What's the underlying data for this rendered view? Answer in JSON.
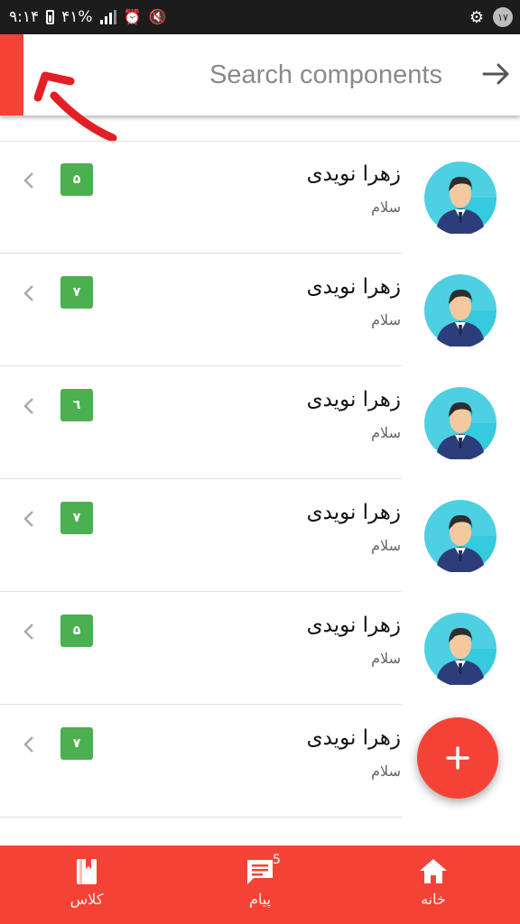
{
  "status_bar": {
    "time": "۹:۱۴",
    "battery": "۴۱%",
    "notification_count": "۱۷"
  },
  "search": {
    "placeholder": "Search components",
    "icon": "arrow-right-icon"
  },
  "conversations": [
    {
      "name": "زهرا نویدی",
      "message": "سلام",
      "count": "۵",
      "avatar": "person-avatar"
    },
    {
      "name": "زهرا نویدی",
      "message": "سلام",
      "count": "۷",
      "avatar": "person-avatar"
    },
    {
      "name": "زهرا نویدی",
      "message": "سلام",
      "count": "٦",
      "avatar": "person-avatar"
    },
    {
      "name": "زهرا نویدی",
      "message": "سلام",
      "count": "۷",
      "avatar": "person-avatar"
    },
    {
      "name": "زهرا نویدی",
      "message": "سلام",
      "count": "۵",
      "avatar": "person-avatar"
    },
    {
      "name": "زهرا نویدی",
      "message": "سلام",
      "count": "۷",
      "avatar": "person-avatar"
    }
  ],
  "fab": {
    "icon": "plus-icon"
  },
  "bottom_nav": {
    "classes_label": "کلاس",
    "messages_label": "پیام",
    "messages_count": "5",
    "home_label": "خانه"
  },
  "colors": {
    "accent": "#f44336",
    "badge": "#4caf50",
    "avatar_bg": "#4dd0e1"
  }
}
